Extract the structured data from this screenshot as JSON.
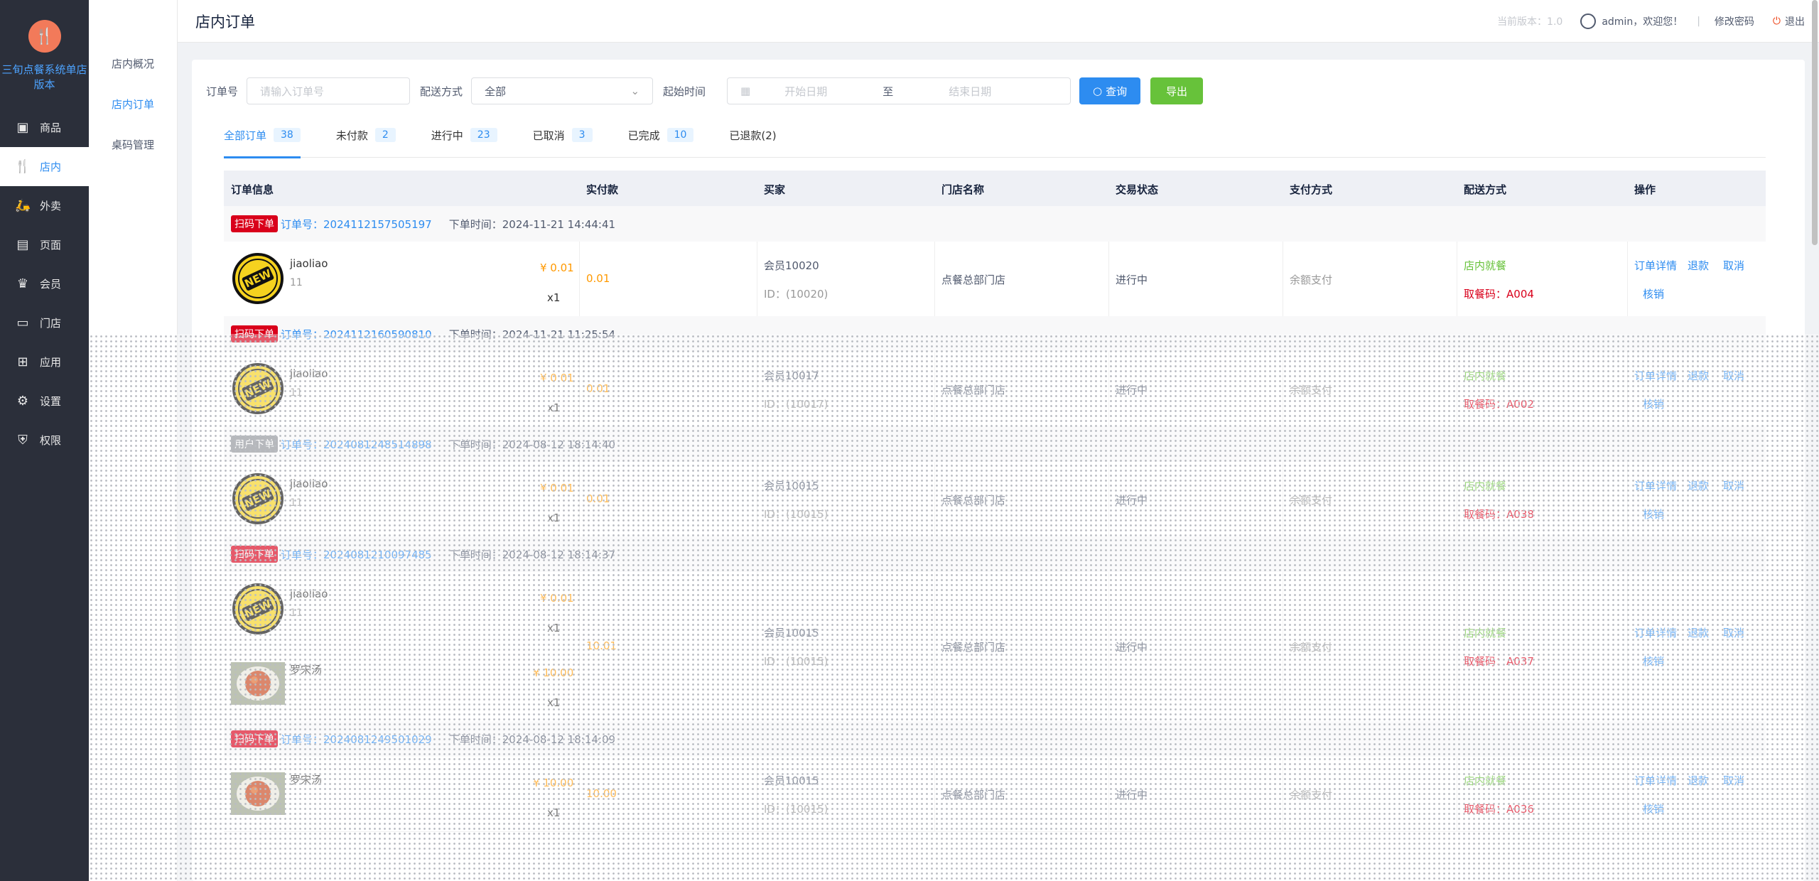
{
  "app": {
    "logo_icon": "fork-knife-icon",
    "logo_text": "三旬点餐系统单店版本"
  },
  "sidebar": {
    "items": [
      {
        "label": "商品",
        "icon": "box-icon"
      },
      {
        "label": "店内",
        "icon": "fork-icon"
      },
      {
        "label": "外卖",
        "icon": "scooter-icon"
      },
      {
        "label": "页面",
        "icon": "page-icon"
      },
      {
        "label": "会员",
        "icon": "crown-icon"
      },
      {
        "label": "门店",
        "icon": "store-icon"
      },
      {
        "label": "应用",
        "icon": "apps-icon"
      },
      {
        "label": "设置",
        "icon": "gear-icon"
      },
      {
        "label": "权限",
        "icon": "shield-icon"
      }
    ]
  },
  "subnav": {
    "items": [
      "店内概况",
      "店内订单",
      "桌码管理"
    ]
  },
  "header": {
    "title": "店内订单",
    "version": "当前版本：1.0",
    "user": "admin，欢迎您！",
    "sep": "|",
    "change_password": "修改密码",
    "logout": "退出"
  },
  "filters": {
    "order_no_label": "订单号",
    "order_no_placeholder": "请输入订单号",
    "delivery_label": "配送方式",
    "delivery_value": "全部",
    "time_label": "起始时间",
    "start_placeholder": "开始日期",
    "to": "至",
    "end_placeholder": "结束日期",
    "search_btn": "查询",
    "export_btn": "导出"
  },
  "tabs": [
    {
      "label": "全部订单",
      "count": "38"
    },
    {
      "label": "未付款",
      "count": "2"
    },
    {
      "label": "进行中",
      "count": "23"
    },
    {
      "label": "已取消",
      "count": "3"
    },
    {
      "label": "已完成",
      "count": "10"
    },
    {
      "label": "已退款(2)",
      "count": ""
    }
  ],
  "columns": [
    "订单信息",
    "实付款",
    "买家",
    "门店名称",
    "交易状态",
    "支付方式",
    "配送方式",
    "操作"
  ],
  "labels": {
    "order_prefix": "订单号：",
    "time_prefix": "下单时间：",
    "id_prefix": "ID：",
    "pickup_prefix": "取餐码："
  },
  "actions": {
    "detail": "订单详情",
    "refund": "退款",
    "cancel": "取消",
    "verify": "核销"
  },
  "orders": [
    {
      "tag": "扫码下单",
      "order_no": "2024112157505197",
      "time": "2024-11-21 14:44:41",
      "items": [
        {
          "name": "jiaoliao",
          "spec": "11",
          "price": "¥ 0.01",
          "qty": "x1",
          "img": "new-badge"
        }
      ],
      "paid": "0.01",
      "buyer": "会员10020",
      "buyer_id": "(10020)",
      "store": "点餐总部门店",
      "status": "进行中",
      "pay": "余额支付",
      "delivery": "店内就餐",
      "pickup": "A004"
    },
    {
      "tag": "扫码下单",
      "order_no": "2024112160590810",
      "time": "2024-11-21 11:25:54",
      "items": [
        {
          "name": "jiaoliao",
          "spec": "11",
          "price": "¥ 0.01",
          "qty": "x1",
          "img": "new-badge"
        }
      ],
      "paid": "0.01",
      "buyer": "会员10017",
      "buyer_id": "(10017)",
      "store": "点餐总部门店",
      "status": "进行中",
      "pay": "余额支付",
      "delivery": "店内就餐",
      "pickup": "A002"
    },
    {
      "tag": "用户下单",
      "order_no": "2024081248514898",
      "time": "2024-08-12 18:14:40",
      "items": [
        {
          "name": "jiaoliao",
          "spec": "11",
          "price": "¥ 0.01",
          "qty": "x1",
          "img": "new-badge"
        }
      ],
      "paid": "0.01",
      "buyer": "会员10015",
      "buyer_id": "(10015)",
      "store": "点餐总部门店",
      "status": "进行中",
      "pay": "余额支付",
      "delivery": "店内就餐",
      "pickup": "A038"
    },
    {
      "tag": "扫码下单",
      "order_no": "2024081210097485",
      "time": "2024-08-12 18:14:37",
      "items": [
        {
          "name": "jiaoliao",
          "spec": "11",
          "price": "¥ 0.01",
          "qty": "x1",
          "img": "new-badge"
        },
        {
          "name": "罗宋汤",
          "spec": "",
          "price": "¥ 10.00",
          "qty": "x1",
          "img": "soup"
        }
      ],
      "paid": "10.01",
      "buyer": "会员10015",
      "buyer_id": "(10015)",
      "store": "点餐总部门店",
      "status": "进行中",
      "pay": "余额支付",
      "delivery": "店内就餐",
      "pickup": "A037"
    },
    {
      "tag": "扫码下单",
      "order_no": "2024081249501029",
      "time": "2024-08-12 18:14:09",
      "items": [
        {
          "name": "罗宋汤",
          "spec": "",
          "price": "¥ 10.00",
          "qty": "x1",
          "img": "soup"
        }
      ],
      "paid": "10.00",
      "buyer": "会员10015",
      "buyer_id": "(10015)",
      "store": "点餐总部门店",
      "status": "进行中",
      "pay": "余额支付",
      "delivery": "店内就餐",
      "pickup": "A036"
    }
  ]
}
